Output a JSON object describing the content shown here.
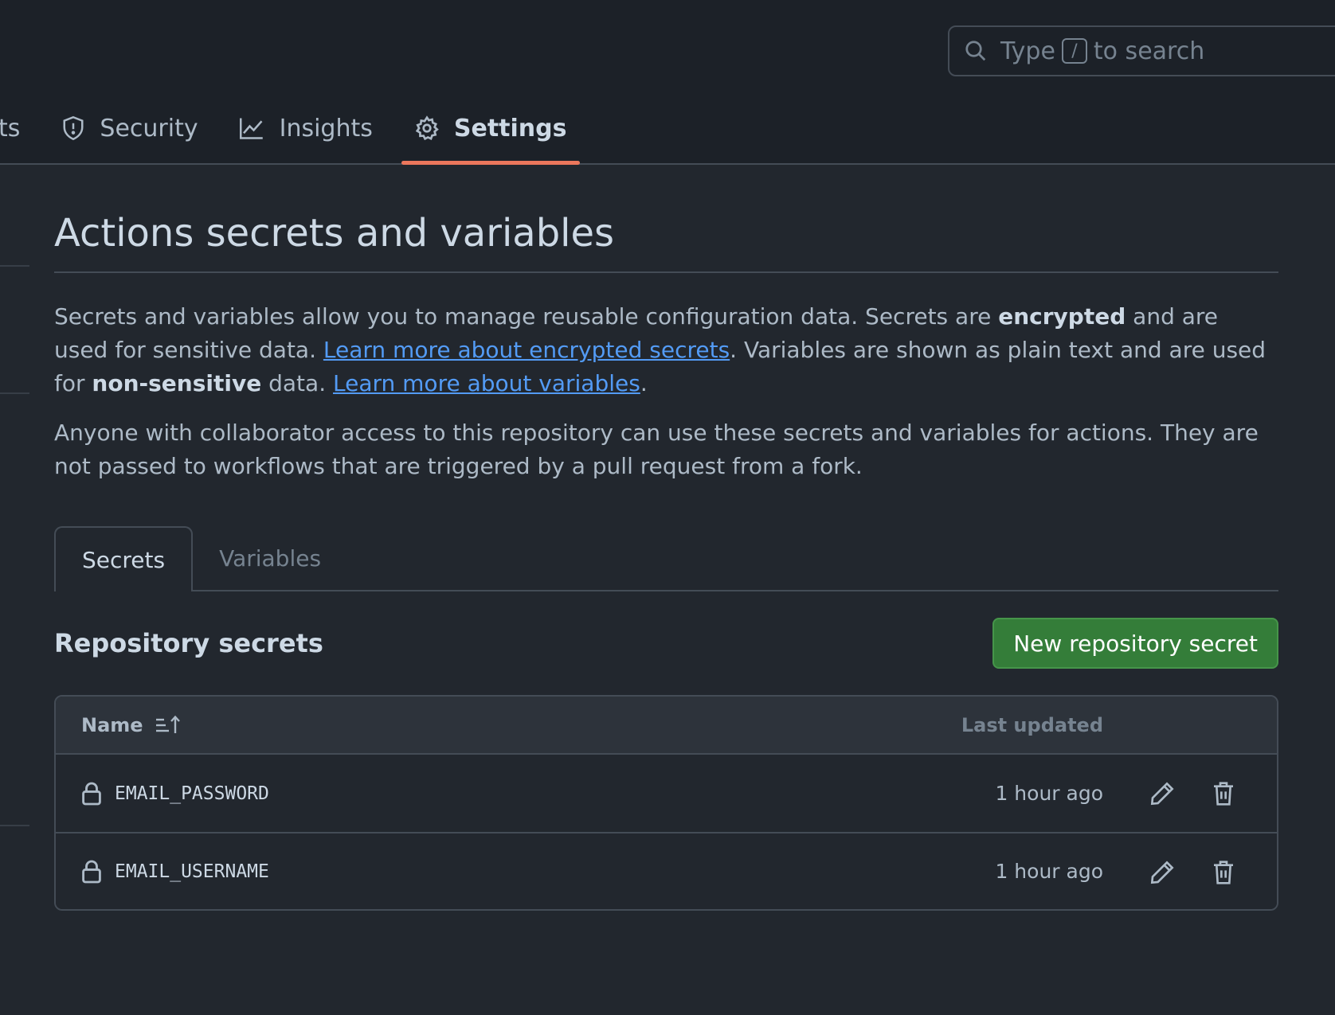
{
  "search": {
    "prefix": "Type",
    "key": "/",
    "suffix": "to search"
  },
  "nav": {
    "partial_label": "ts",
    "security": "Security",
    "insights": "Insights",
    "settings": "Settings",
    "active_color": "#ec775c"
  },
  "page": {
    "title": "Actions secrets and variables",
    "intro": {
      "t1": "Secrets and variables allow you to manage reusable configuration data. Secrets are ",
      "b1": "encrypted",
      "t2": " and are used for sensitive data. ",
      "link1": "Learn more about encrypted secrets",
      "t3": ". Variables are shown as plain text and are used for ",
      "b2": "non-sensitive",
      "t4": " data. ",
      "link2": "Learn more about variables",
      "t5": "."
    },
    "note": "Anyone with collaborator access to this repository can use these secrets and variables for actions. They are not passed to workflows that are triggered by a pull request from a fork."
  },
  "tabs": {
    "secrets": "Secrets",
    "variables": "Variables"
  },
  "repo_secrets": {
    "title": "Repository secrets",
    "new_button": "New repository secret",
    "button_color": "#347d39",
    "col_name": "Name",
    "col_updated": "Last updated",
    "rows": [
      {
        "name": "EMAIL_PASSWORD",
        "updated": "1 hour ago"
      },
      {
        "name": "EMAIL_USERNAME",
        "updated": "1 hour ago"
      }
    ]
  }
}
